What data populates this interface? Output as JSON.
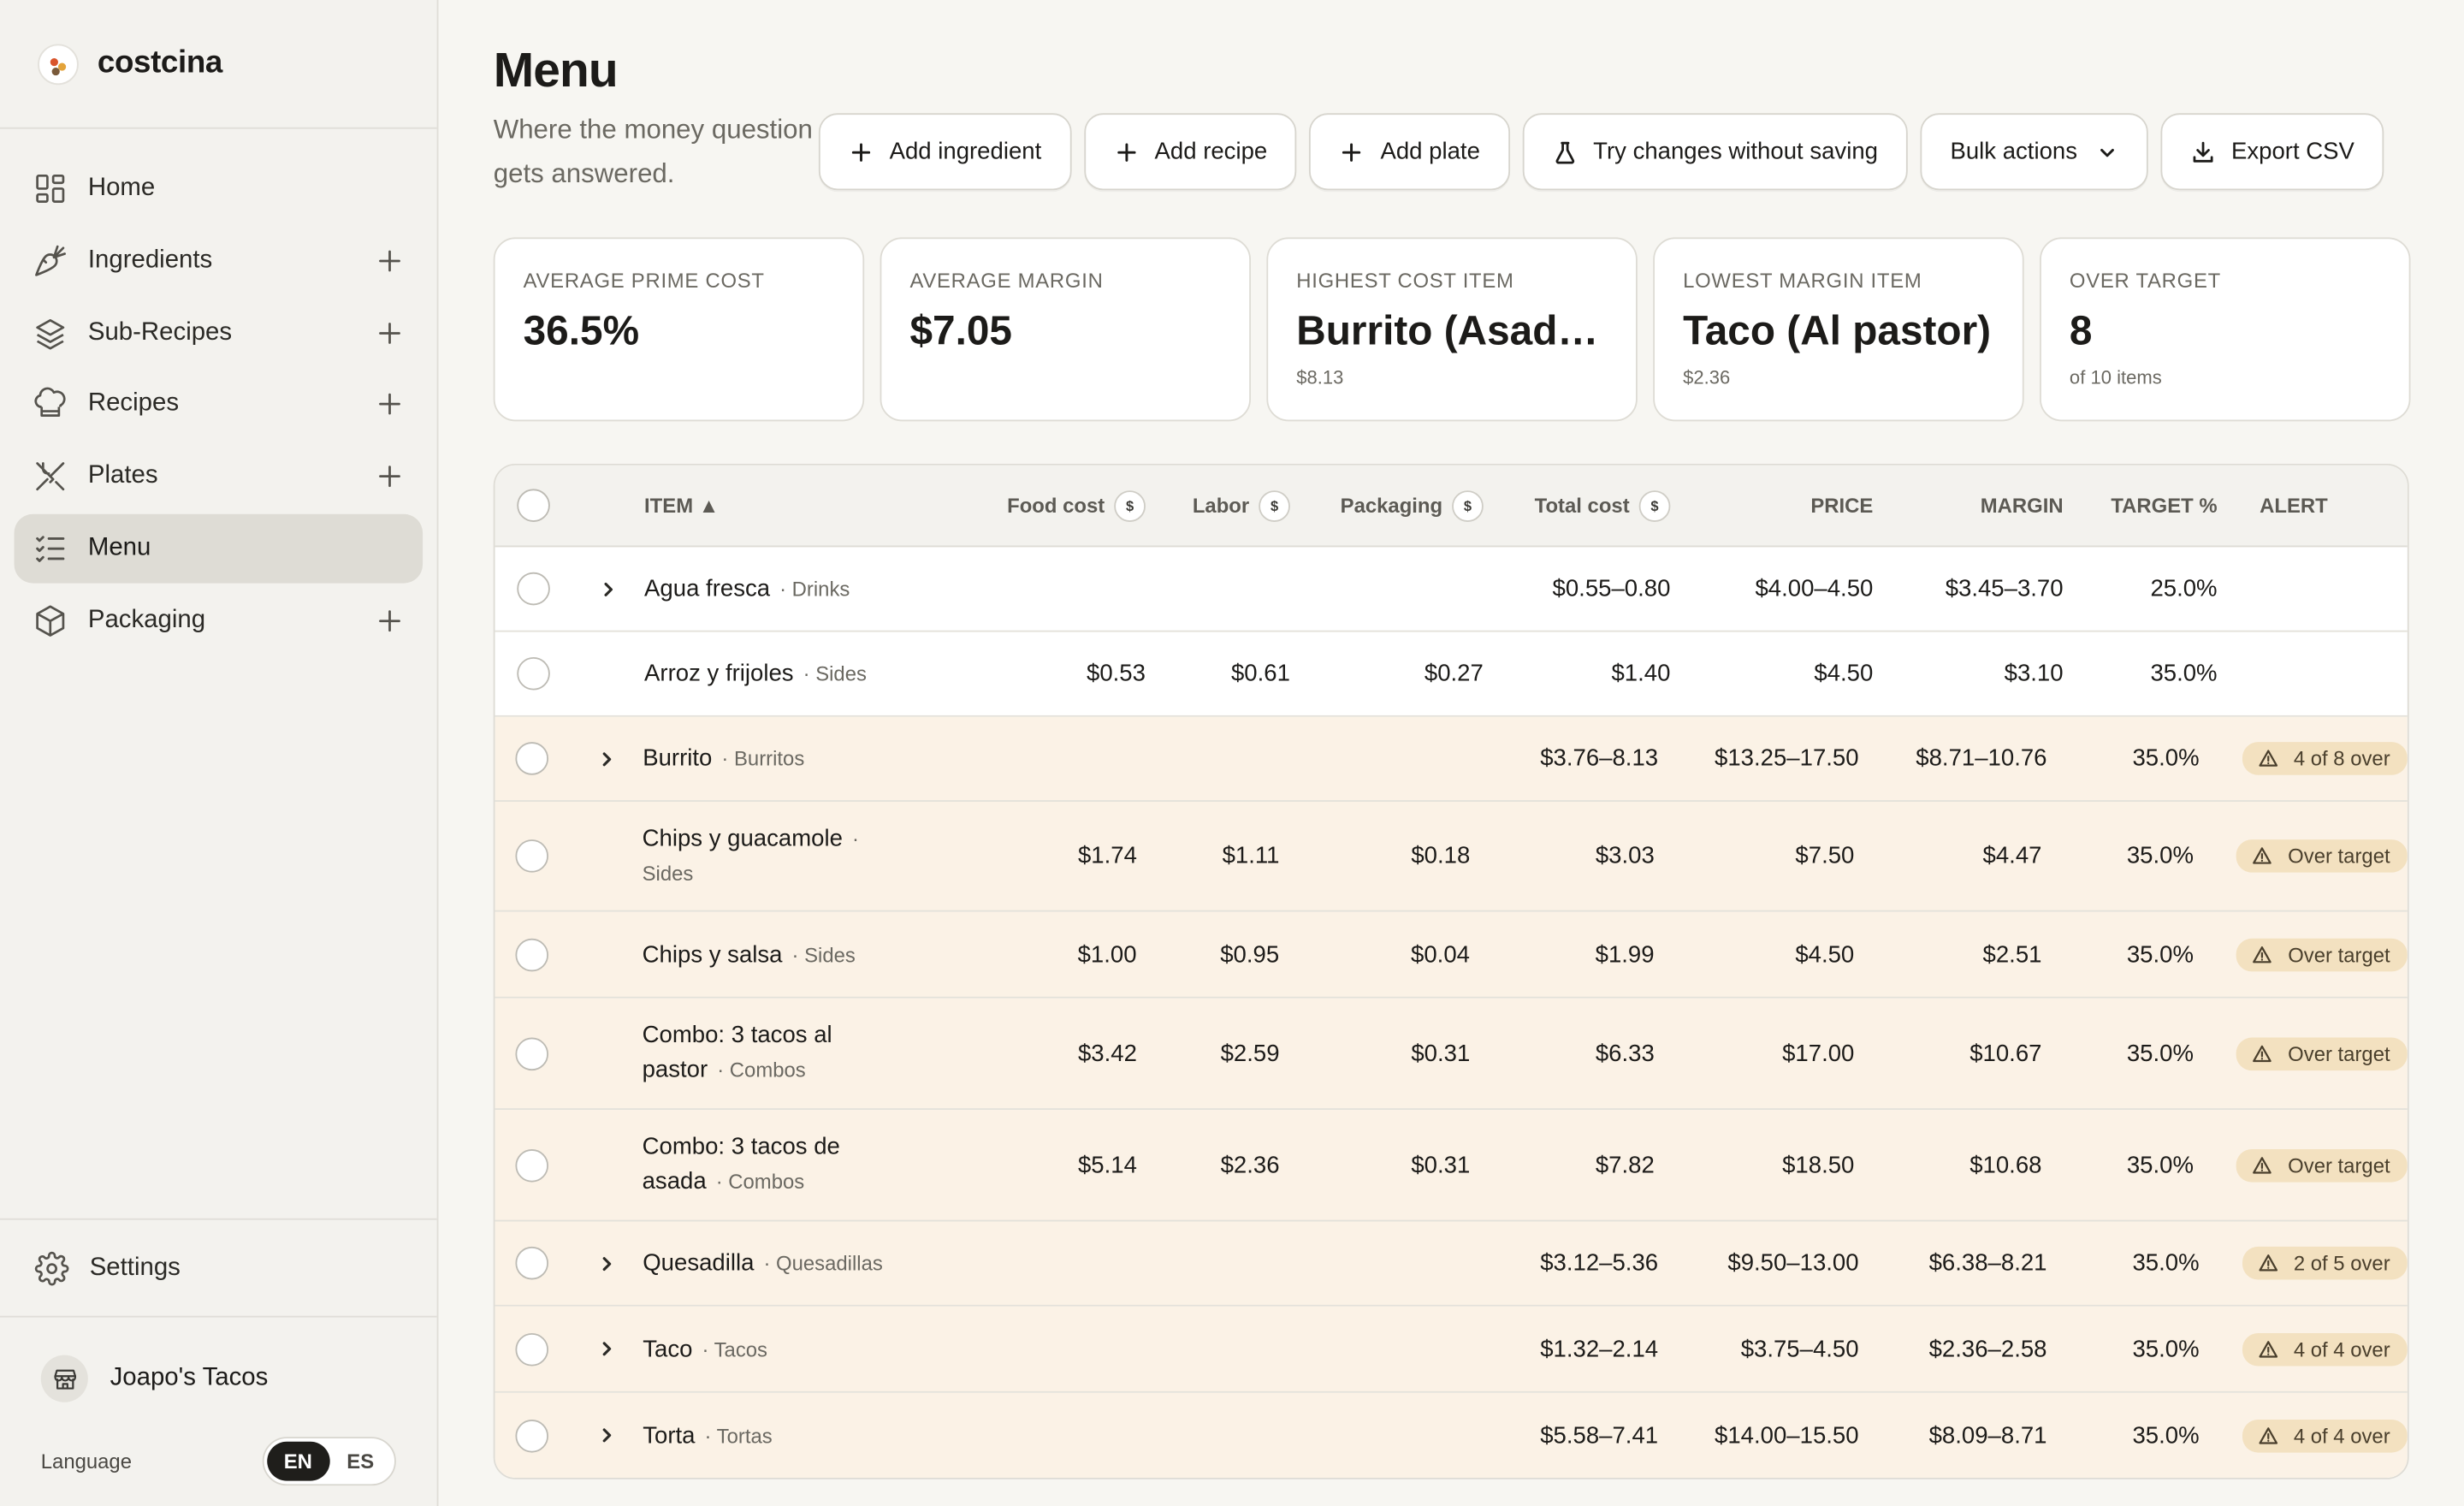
{
  "app": {
    "name": "costcina"
  },
  "sidebar": {
    "items": [
      {
        "label": "Home",
        "icon": "home-icon",
        "has_add": false,
        "active": false
      },
      {
        "label": "Ingredients",
        "icon": "carrot-icon",
        "has_add": true,
        "active": false
      },
      {
        "label": "Sub-Recipes",
        "icon": "layers-icon",
        "has_add": true,
        "active": false
      },
      {
        "label": "Recipes",
        "icon": "chef-hat-icon",
        "has_add": true,
        "active": false
      },
      {
        "label": "Plates",
        "icon": "utensils-icon",
        "has_add": true,
        "active": false
      },
      {
        "label": "Menu",
        "icon": "list-check-icon",
        "has_add": false,
        "active": true
      },
      {
        "label": "Packaging",
        "icon": "box-icon",
        "has_add": true,
        "active": false
      }
    ],
    "settings_label": "Settings",
    "org_name": "Joapo's Tacos",
    "language_label": "Language",
    "languages": [
      "EN",
      "ES"
    ],
    "active_language": "EN"
  },
  "page": {
    "title": "Menu",
    "subtitle": "Where the money question gets answered."
  },
  "toolbar": {
    "add_ingredient": "Add ingredient",
    "add_recipe": "Add recipe",
    "add_plate": "Add plate",
    "try_changes": "Try changes without saving",
    "bulk_actions": "Bulk actions",
    "export_csv": "Export CSV"
  },
  "stats": [
    {
      "label": "AVERAGE PRIME COST",
      "value": "36.5%",
      "sub": ""
    },
    {
      "label": "AVERAGE MARGIN",
      "value": "$7.05",
      "sub": ""
    },
    {
      "label": "HIGHEST COST ITEM",
      "value": "Burrito (Asad…",
      "sub": "$8.13"
    },
    {
      "label": "LOWEST MARGIN ITEM",
      "value": "Taco (Al pastor)",
      "sub": "$2.36"
    },
    {
      "label": "OVER TARGET",
      "value": "8",
      "sub": "of 10 items"
    }
  ],
  "table": {
    "headers": {
      "item": "ITEM ▲",
      "food": "Food cost",
      "labor": "Labor",
      "packaging": "Packaging",
      "total": "Total cost",
      "price": "PRICE",
      "margin": "MARGIN",
      "target": "TARGET %",
      "alert": "ALERT",
      "dollar": "$"
    },
    "rows": [
      {
        "name": "Agua fresca",
        "cat": "· Drinks",
        "expandable": true,
        "food": "",
        "labor": "",
        "packaging": "",
        "total": "$0.55–0.80",
        "price": "$4.00–4.50",
        "margin": "$3.45–3.70",
        "target": "25.0%",
        "alert": "",
        "warn": false,
        "height": 54
      },
      {
        "name": "Arroz y frijoles",
        "cat": "· Sides",
        "expandable": false,
        "food": "$0.53",
        "labor": "$0.61",
        "packaging": "$0.27",
        "total": "$1.40",
        "price": "$4.50",
        "margin": "$3.10",
        "target": "35.0%",
        "alert": "",
        "warn": false,
        "height": 54
      },
      {
        "name": "Burrito",
        "cat": "· Burritos",
        "expandable": true,
        "food": "",
        "labor": "",
        "packaging": "",
        "total": "$3.76–8.13",
        "price": "$13.25–17.50",
        "margin": "$8.71–10.76",
        "target": "35.0%",
        "alert": "4 of 8 over",
        "warn": true,
        "height": 54
      },
      {
        "name": "Chips y guacamole",
        "cat": "· Sides",
        "expandable": false,
        "food": "$1.74",
        "labor": "$1.11",
        "packaging": "$0.18",
        "total": "$3.03",
        "price": "$7.50",
        "margin": "$4.47",
        "target": "35.0%",
        "alert": "Over target",
        "warn": true,
        "height": 70
      },
      {
        "name": "Chips y salsa",
        "cat": "· Sides",
        "expandable": false,
        "food": "$1.00",
        "labor": "$0.95",
        "packaging": "$0.04",
        "total": "$1.99",
        "price": "$4.50",
        "margin": "$2.51",
        "target": "35.0%",
        "alert": "Over target",
        "warn": true,
        "height": 55
      },
      {
        "name": "Combo: 3 tacos al pastor",
        "cat": "· Combos",
        "expandable": false,
        "food": "$3.42",
        "labor": "$2.59",
        "packaging": "$0.31",
        "total": "$6.33",
        "price": "$17.00",
        "margin": "$10.67",
        "target": "35.0%",
        "alert": "Over target",
        "warn": true,
        "height": 71
      },
      {
        "name": "Combo: 3 tacos de asada",
        "cat": "· Combos",
        "expandable": false,
        "food": "$5.14",
        "labor": "$2.36",
        "packaging": "$0.31",
        "total": "$7.82",
        "price": "$18.50",
        "margin": "$10.68",
        "target": "35.0%",
        "alert": "Over target",
        "warn": true,
        "height": 71
      },
      {
        "name": "Quesadilla",
        "cat": "· Quesadillas",
        "expandable": true,
        "food": "",
        "labor": "",
        "packaging": "",
        "total": "$3.12–5.36",
        "price": "$9.50–13.00",
        "margin": "$6.38–8.21",
        "target": "35.0%",
        "alert": "2 of 5 over",
        "warn": true,
        "height": 54
      },
      {
        "name": "Taco",
        "cat": "· Tacos",
        "expandable": true,
        "food": "",
        "labor": "",
        "packaging": "",
        "total": "$1.32–2.14",
        "price": "$3.75–4.50",
        "margin": "$2.36–2.58",
        "target": "35.0%",
        "alert": "4 of 4 over",
        "warn": true,
        "height": 55
      },
      {
        "name": "Torta",
        "cat": "· Tortas",
        "expandable": true,
        "food": "",
        "labor": "",
        "packaging": "",
        "total": "$5.58–7.41",
        "price": "$14.00–15.50",
        "margin": "$8.09–8.71",
        "target": "35.0%",
        "alert": "4 of 4 over",
        "warn": true,
        "height": 54
      }
    ]
  },
  "colors": {
    "accent": "#1f1e1b",
    "warn_row": "#fbf2e6",
    "warn_badge": "#f3e1c0",
    "active_nav": "#dedcd5"
  }
}
